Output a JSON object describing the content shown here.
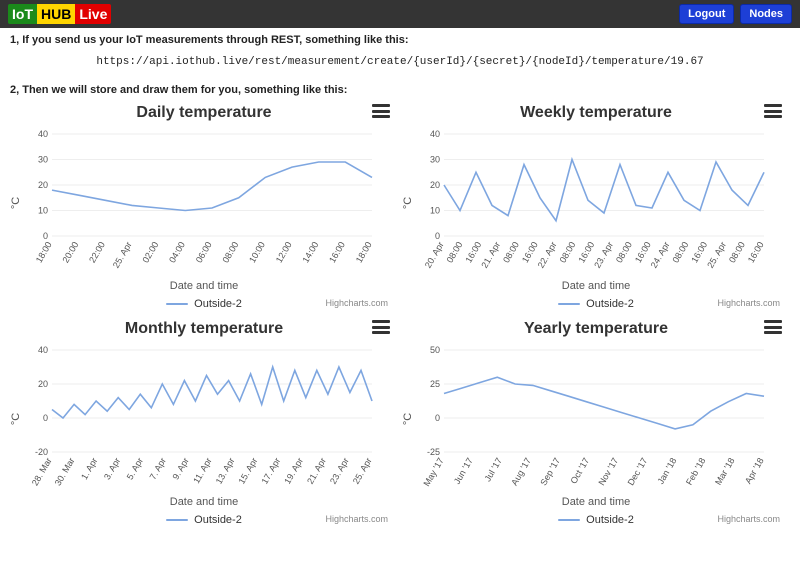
{
  "logo": {
    "iot": "IoT",
    "hub": "HUB",
    "live": "Live"
  },
  "buttons": {
    "logout": "Logout",
    "nodes": "Nodes"
  },
  "intro1": "1, If you send us your IoT measurements through REST, something like this:",
  "api_url": "https://api.iothub.live/rest/measurement/create/{userId}/{secret}/{nodeId}/temperature/19.67",
  "intro2": "2, Then we will store and draw them for you, something like this:",
  "legend_series": "Outside-2",
  "credit": "Highcharts.com",
  "xlabel": "Date and time",
  "ylabel": "°C",
  "chart_data": [
    {
      "id": "daily",
      "type": "line",
      "title": "Daily temperature",
      "ylim": [
        0,
        40
      ],
      "yticks": [
        0,
        10,
        20,
        30,
        40
      ],
      "categories": [
        "18:00",
        "20:00",
        "22:00",
        "25. Apr",
        "02:00",
        "04:00",
        "06:00",
        "08:00",
        "10:00",
        "12:00",
        "14:00",
        "16:00",
        "18:00"
      ],
      "xtick_rot": -60,
      "series": [
        {
          "name": "Outside-2",
          "values": [
            18,
            16,
            14,
            12,
            11,
            10,
            11,
            15,
            23,
            27,
            29,
            29,
            23
          ]
        }
      ]
    },
    {
      "id": "weekly",
      "type": "line",
      "title": "Weekly temperature",
      "ylim": [
        0,
        40
      ],
      "yticks": [
        0,
        10,
        20,
        30,
        40
      ],
      "categories": [
        "20. Apr",
        "08:00",
        "16:00",
        "21. Apr",
        "08:00",
        "16:00",
        "22. Apr",
        "08:00",
        "16:00",
        "23. Apr",
        "08:00",
        "16:00",
        "24. Apr",
        "08:00",
        "16:00",
        "25. Apr",
        "08:00",
        "16:00"
      ],
      "xtick_rot": -60,
      "series": [
        {
          "name": "Outside-2",
          "values": [
            20,
            10,
            25,
            12,
            8,
            28,
            15,
            6,
            30,
            14,
            9,
            28,
            12,
            11,
            25,
            14,
            10,
            29,
            18,
            12,
            25
          ]
        }
      ]
    },
    {
      "id": "monthly",
      "type": "line",
      "title": "Monthly temperature",
      "ylim": [
        -20,
        40
      ],
      "yticks": [
        -20,
        0,
        20,
        40
      ],
      "categories": [
        "28. Mar",
        "30. Mar",
        "1. Apr",
        "3. Apr",
        "5. Apr",
        "7. Apr",
        "9. Apr",
        "11. Apr",
        "13. Apr",
        "15. Apr",
        "17. Apr",
        "19. Apr",
        "21. Apr",
        "23. Apr",
        "25. Apr"
      ],
      "xtick_rot": -60,
      "series": [
        {
          "name": "Outside-2",
          "values": [
            5,
            0,
            8,
            2,
            10,
            4,
            12,
            5,
            14,
            6,
            20,
            8,
            22,
            10,
            25,
            14,
            22,
            10,
            26,
            8,
            30,
            10,
            28,
            12,
            28,
            14,
            30,
            15,
            28,
            10
          ]
        }
      ]
    },
    {
      "id": "yearly",
      "type": "line",
      "title": "Yearly temperature",
      "ylim": [
        -25,
        50
      ],
      "yticks": [
        -25,
        0,
        25,
        50
      ],
      "categories": [
        "May '17",
        "Jun '17",
        "Jul '17",
        "Aug '17",
        "Sep '17",
        "Oct '17",
        "Nov '17",
        "Dec '17",
        "Jan '18",
        "Feb '18",
        "Mar '18",
        "Apr '18"
      ],
      "xtick_rot": -60,
      "series": [
        {
          "name": "Outside-2",
          "values": [
            18,
            22,
            26,
            30,
            25,
            24,
            20,
            16,
            12,
            8,
            4,
            0,
            -4,
            -8,
            -5,
            5,
            12,
            18,
            16
          ]
        }
      ]
    }
  ]
}
